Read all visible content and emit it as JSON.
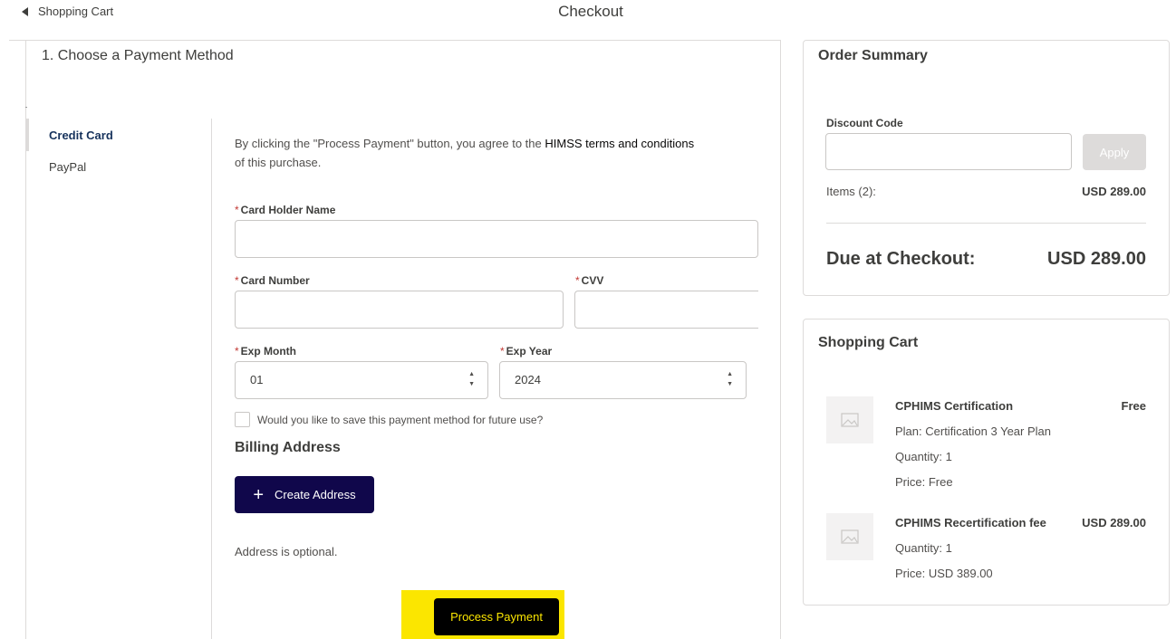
{
  "header": {
    "back_label": "Shopping Cart",
    "title": "Checkout"
  },
  "payment": {
    "section_title": "1. Choose a Payment Method",
    "tabs": [
      {
        "label": "Credit Card",
        "active": true
      },
      {
        "label": "PayPal",
        "active": false
      }
    ],
    "terms_prefix": "By clicking the \"Process Payment\" button, you agree to the ",
    "terms_link": "HIMSS terms and conditions",
    "terms_suffix": "of this purchase.",
    "required_mark": "*",
    "card_holder_label": "Card Holder Name",
    "card_holder_value": "",
    "card_number_label": "Card Number",
    "card_number_value": "",
    "cvv_label": "CVV",
    "cvv_value": "",
    "exp_month_label": "Exp Month",
    "exp_month_value": "01",
    "exp_year_label": "Exp Year",
    "exp_year_value": "2024",
    "save_method_label": "Would you like to save this payment method for future use?",
    "save_method_checked": false,
    "billing_title": "Billing Address",
    "create_address_label": "Create Address",
    "address_optional": "Address is optional.",
    "process_payment_label": "Process Payment",
    "highlight_color": "#fbe600",
    "button_color": "#10074b"
  },
  "order_summary": {
    "title": "Order Summary",
    "discount_label": "Discount Code",
    "discount_value": "",
    "apply_label": "Apply",
    "items_label": "Items (2):",
    "items_total": "USD 289.00",
    "due_label": "Due at Checkout:",
    "due_total": "USD 289.00"
  },
  "cart": {
    "title": "Shopping Cart",
    "items": [
      {
        "name": "CPHIMS Certification",
        "price": "Free",
        "plan": "Plan: Certification 3 Year Plan",
        "quantity": "Quantity: 1",
        "unit_price": "Price:  Free"
      },
      {
        "name": "CPHIMS Recertification fee",
        "price": "USD 289.00",
        "quantity": "Quantity: 1",
        "unit_price": "Price:  USD 389.00"
      }
    ]
  }
}
